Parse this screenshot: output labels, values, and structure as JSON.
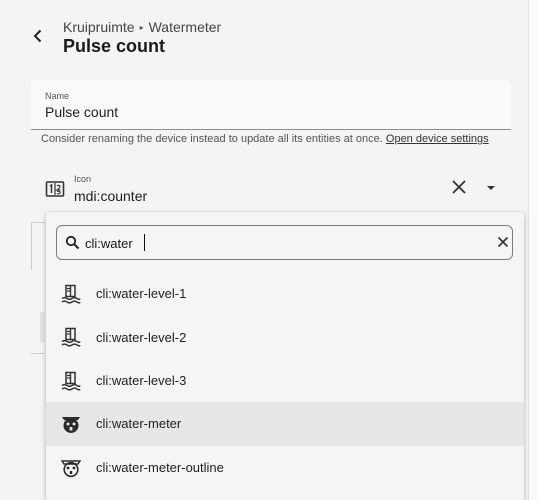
{
  "header": {
    "breadcrumb": [
      "Kruipruimte",
      "Watermeter"
    ],
    "breadcrumb_separator": "▸",
    "title": "Pulse count"
  },
  "name_field": {
    "label": "Name",
    "value": "Pulse count"
  },
  "helper": {
    "text": "Consider renaming the device instead to update all its entities at once.",
    "link": "Open device settings"
  },
  "icon_field": {
    "label": "Icon",
    "value": "mdi:counter",
    "preview_icon": "counter-icon"
  },
  "icon_search": {
    "query": "cli:water",
    "results": [
      {
        "label": "cli:water-level-1",
        "icon": "water-level-icon"
      },
      {
        "label": "cli:water-level-2",
        "icon": "water-level-icon"
      },
      {
        "label": "cli:water-level-3",
        "icon": "water-level-icon"
      },
      {
        "label": "cli:water-meter",
        "icon": "water-meter-icon",
        "highlighted": true
      },
      {
        "label": "cli:water-meter-outline",
        "icon": "water-meter-outline-icon"
      }
    ]
  },
  "colors": {
    "background": "#f4f4f4",
    "highlight": "#e6e6e6",
    "text": "#212121"
  }
}
